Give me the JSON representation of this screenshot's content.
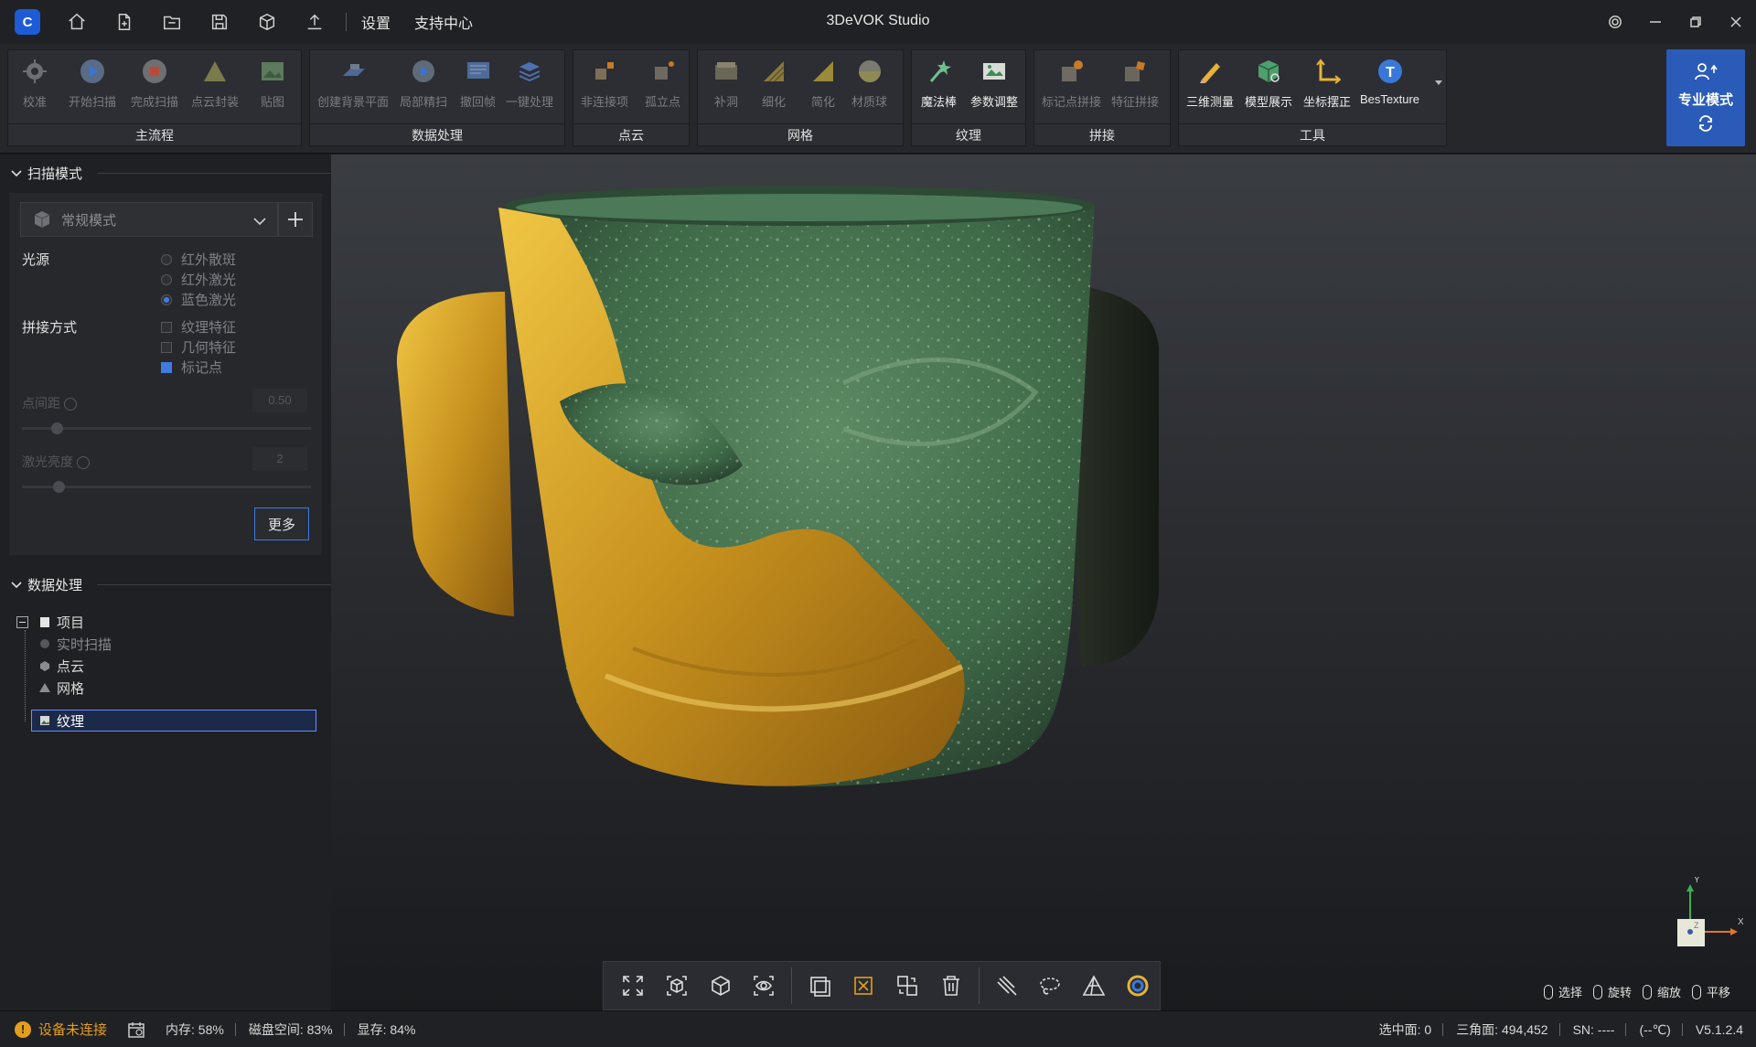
{
  "titlebar": {
    "app_title": "3DeVOK Studio",
    "menu": [
      "设置",
      "支持中心"
    ],
    "icons": [
      "home-icon",
      "new-file-icon",
      "open-file-icon",
      "save-icon",
      "cube-icon",
      "upload-icon"
    ]
  },
  "ribbon": {
    "groups": [
      {
        "label": "主流程",
        "buttons": [
          "校准",
          "开始扫描",
          "完成扫描",
          "点云封装",
          "贴图"
        ]
      },
      {
        "label": "数据处理",
        "buttons": [
          "创建背景平面",
          "局部精扫",
          "撤回帧",
          "一键处理"
        ]
      },
      {
        "label": "点云",
        "buttons": [
          "非连接项",
          "孤立点"
        ]
      },
      {
        "label": "网格",
        "buttons": [
          "补洞",
          "细化",
          "简化",
          "材质球"
        ]
      },
      {
        "label": "纹理",
        "buttons": [
          "魔法棒",
          "参数调整"
        ]
      },
      {
        "label": "拼接",
        "buttons": [
          "标记点拼接",
          "特征拼接"
        ]
      },
      {
        "label": "工具",
        "buttons": [
          "三维测量",
          "模型展示",
          "坐标摆正",
          "BesTexture"
        ]
      }
    ],
    "pro_mode_label": "专业模式"
  },
  "scan_panel": {
    "title": "扫描模式",
    "mode_value": "常规模式",
    "light_label": "光源",
    "light_options": [
      {
        "label": "红外散斑",
        "selected": false
      },
      {
        "label": "红外激光",
        "selected": false
      },
      {
        "label": "蓝色激光",
        "selected": true
      }
    ],
    "stitch_label": "拼接方式",
    "stitch_options": [
      {
        "label": "纹理特征",
        "checked": false
      },
      {
        "label": "几何特征",
        "checked": false
      },
      {
        "label": "标记点",
        "checked": true
      }
    ],
    "point_spacing_label": "点间距",
    "point_spacing_value": "0.50",
    "laser_brightness_label": "激光亮度",
    "laser_brightness_value": "2",
    "more_label": "更多"
  },
  "data_panel": {
    "title": "数据处理",
    "tree": [
      {
        "label": "项目",
        "icon": "folder-icon"
      },
      {
        "label": "实时扫描",
        "icon": "scan-icon"
      },
      {
        "label": "点云",
        "icon": "pointcloud-icon"
      },
      {
        "label": "网格",
        "icon": "mesh-icon"
      },
      {
        "label": "纹理",
        "icon": "texture-icon"
      }
    ]
  },
  "viewport": {
    "mouse_hints": [
      "选择",
      "旋转",
      "缩放",
      "平移"
    ],
    "axis": {
      "x": "X",
      "y": "Y",
      "z": "Z"
    }
  },
  "statusbar": {
    "device_status": "设备未连接",
    "memory": "内存: 58%",
    "disk": "磁盘空间: 83%",
    "vram": "显存: 84%",
    "selected": "选中面: 0",
    "triangles": "三角面: 494,452",
    "sn": "SN: ----",
    "temp": "(--℃)",
    "version": "V5.1.2.4"
  },
  "colors": {
    "accent": "#2a5bb8",
    "warning": "#e39e1c",
    "gold": "#c89a22",
    "bronze_green": "#3f6a48"
  }
}
